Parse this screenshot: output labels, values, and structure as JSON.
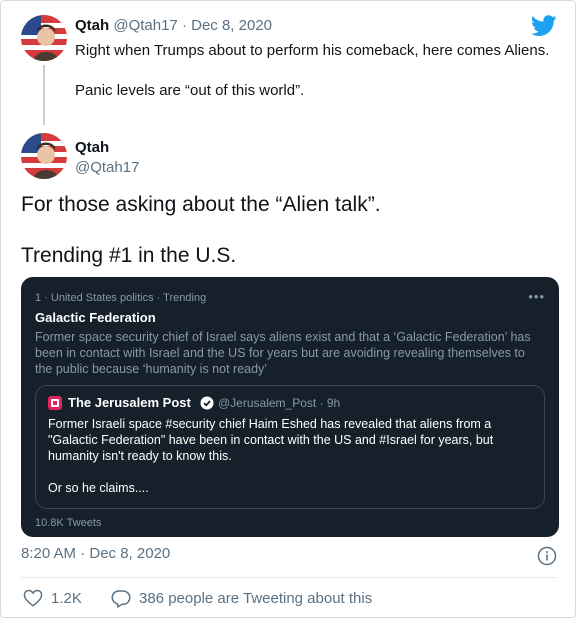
{
  "parent_tweet": {
    "name": "Qtah",
    "handle": "@Qtah17",
    "separator": "·",
    "date": "Dec 8, 2020",
    "text_line1": "Right when Trumps about to perform his comeback, here comes Aliens.",
    "text_line2": "Panic levels are “out of this world”."
  },
  "main_tweet": {
    "name": "Qtah",
    "handle": "@Qtah17",
    "text_line1": "For those asking about the “Alien talk”.",
    "text_line2": "Trending #1 in the U.S."
  },
  "embed": {
    "meta": "1 · United States politics · Trending",
    "more": "•••",
    "topic": "Galactic Federation",
    "description": "Former space security chief of Israel says aliens exist and that a ‘Galactic Federation’ has been in contact with Israel and the US for years but are avoiding revealing themselves to the public because ‘humanity is not ready’",
    "quote": {
      "name": "The Jerusalem Post",
      "handle_time": "@Jerusalem_Post · 9h",
      "text_line1": "Former Israeli space #security chief Haim Eshed has revealed that aliens from a \"Galactic Federation\" have been in contact with the US and #Israel for years, but humanity isn't ready to know this.",
      "text_line2": "Or so he claims...."
    },
    "tweet_count": "10.8K Tweets"
  },
  "timestamp": "8:20 AM · Dec 8, 2020",
  "actions": {
    "likes": "1.2K",
    "people_tweeting": "386 people are Tweeting about this"
  },
  "colors": {
    "twitter_blue": "#1da1f2",
    "embed_bg": "#15202b",
    "muted": "#5b7083",
    "brand_red": "#e0245e"
  }
}
